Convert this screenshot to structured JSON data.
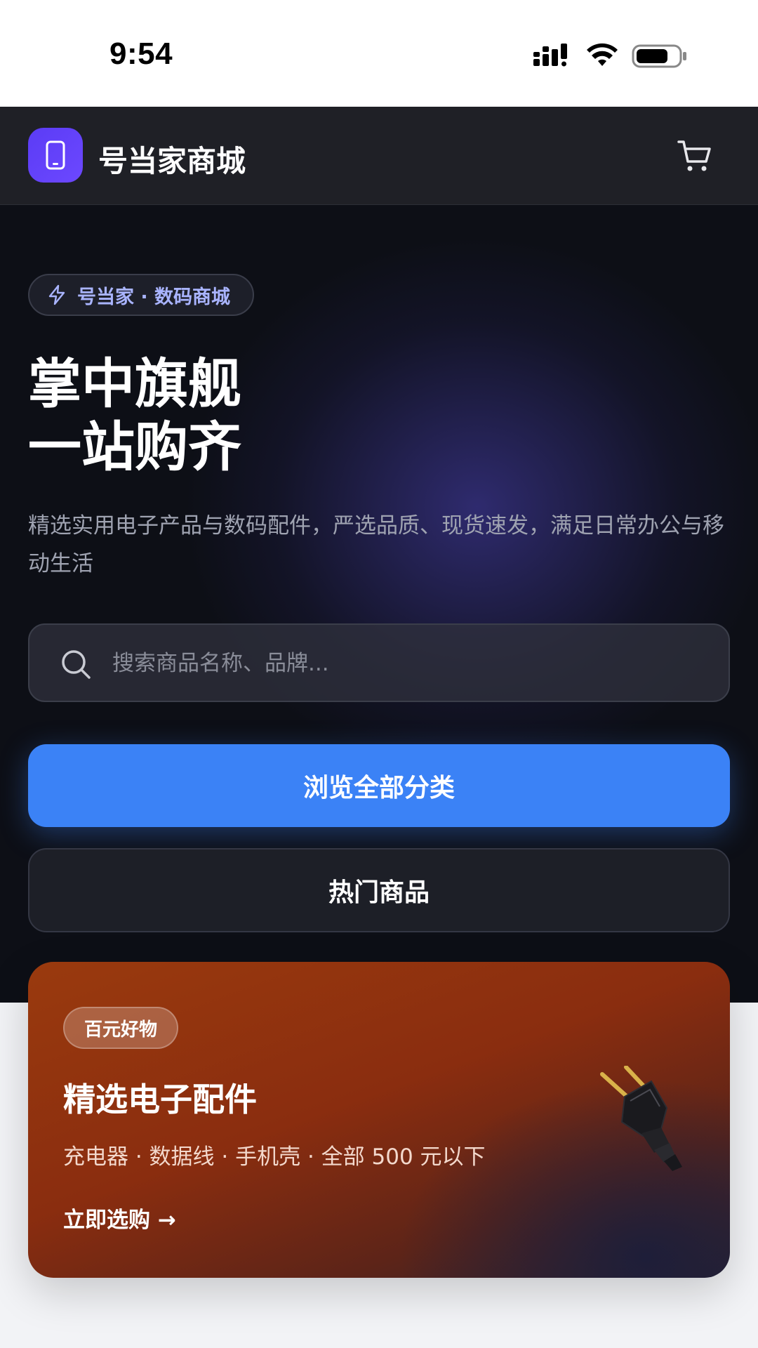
{
  "status_bar": {
    "time": "9:54"
  },
  "header": {
    "app_title": "号当家商城",
    "logo_icon": "phone-icon",
    "cart_icon": "cart-icon"
  },
  "hero": {
    "tag": "号当家 · 数码商城",
    "title_line1": "掌中旗舰",
    "title_line2": "一站购齐",
    "subtitle": "精选实用电子产品与数码配件，严选品质、现货速发，满足日常办公与移动生活",
    "search": {
      "placeholder": "搜索商品名称、品牌...",
      "value": ""
    },
    "primary_button": "浏览全部分类",
    "secondary_button": "热门商品"
  },
  "promo": {
    "badge": "百元好物",
    "title": "精选电子配件",
    "description": "充电器 · 数据线 · 手机壳 · 全部 500 元以下",
    "cta": "立即选购 →",
    "image_icon": "plug-icon"
  },
  "colors": {
    "accent_purple": "#5b3cf5",
    "primary_blue": "#3b82f6",
    "hero_bg": "#0d0f16",
    "promo_orange": "#8a2d0f"
  }
}
